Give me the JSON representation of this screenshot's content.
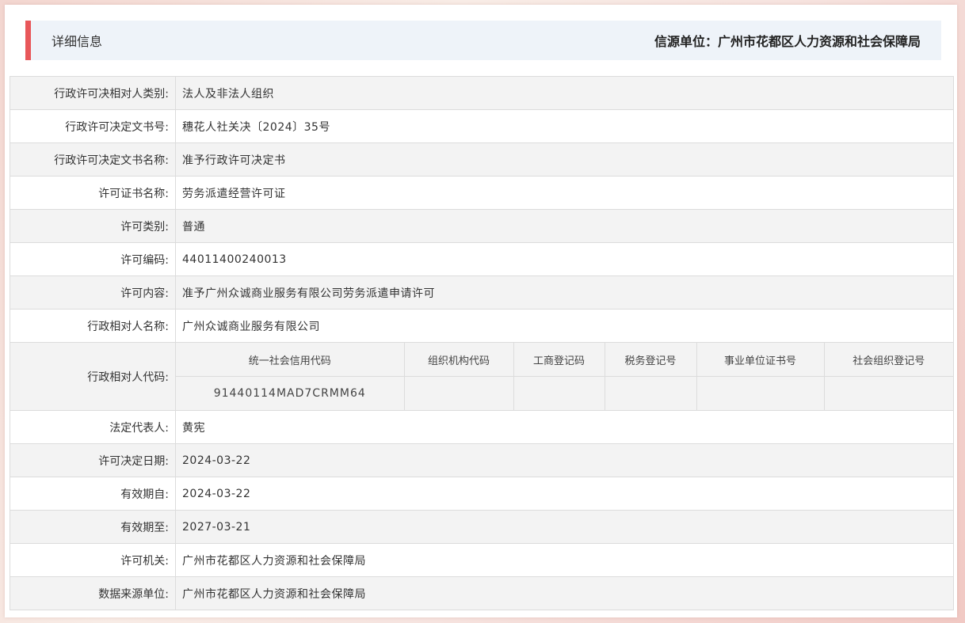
{
  "header": {
    "title": "详细信息",
    "source": "信源单位：广州市花都区人力资源和社会保障局"
  },
  "rows_top": [
    {
      "label": "行政许可决相对人类别:",
      "value": "法人及非法人组织"
    },
    {
      "label": "行政许可决定文书号:",
      "value": "穗花人社关决〔2024〕35号"
    },
    {
      "label": "行政许可决定文书名称:",
      "value": "准予行政许可决定书"
    },
    {
      "label": "许可证书名称:",
      "value": "劳务派遣经营许可证"
    },
    {
      "label": "许可类别:",
      "value": "普通"
    },
    {
      "label": "许可编码:",
      "value": "44011400240013"
    },
    {
      "label": "许可内容:",
      "value": "准予广州众诚商业服务有限公司劳务派遣申请许可"
    },
    {
      "label": "行政相对人名称:",
      "value": "广州众诚商业服务有限公司"
    }
  ],
  "code_row": {
    "label": "行政相对人代码:",
    "headers": [
      "统一社会信用代码",
      "组织机构代码",
      "工商登记码",
      "税务登记号",
      "事业单位证书号",
      "社会组织登记号"
    ],
    "values": [
      "91440114MAD7CRMM64",
      "",
      "",
      "",
      "",
      ""
    ]
  },
  "rows_bottom": [
    {
      "label": "法定代表人:",
      "value": "黄宪"
    },
    {
      "label": "许可决定日期:",
      "value": "2024-03-22"
    },
    {
      "label": "有效期自:",
      "value": "2024-03-22"
    },
    {
      "label": "有效期至:",
      "value": "2027-03-21"
    },
    {
      "label": "许可机关:",
      "value": "广州市花都区人力资源和社会保障局"
    },
    {
      "label": "数据来源单位:",
      "value": "广州市花都区人力资源和社会保障局"
    }
  ],
  "colors": {
    "accent": "#e8575a",
    "header_bg": "#eef3f9",
    "stripe": "#f3f3f3",
    "border": "#dcdcdc"
  }
}
